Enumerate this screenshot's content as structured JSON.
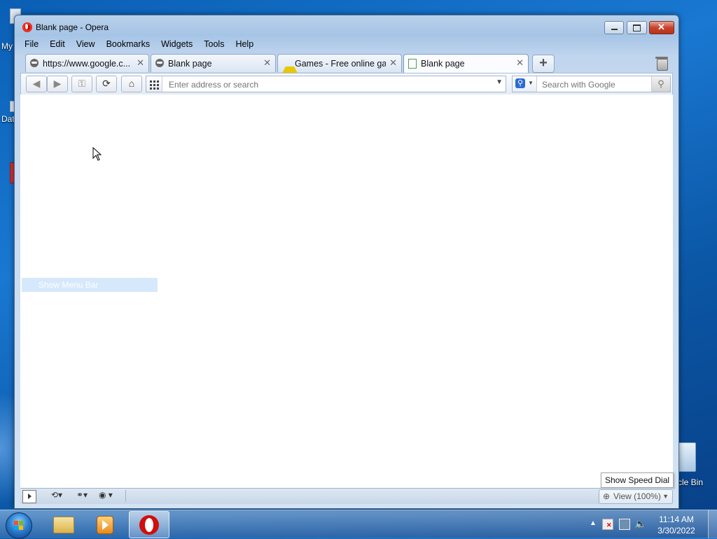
{
  "desktop": {
    "icons": [
      {
        "label": "My"
      },
      {
        "label": "Dat"
      },
      {
        "label": "cle Bin"
      }
    ]
  },
  "window": {
    "title": "Blank page - Opera",
    "menu": [
      "File",
      "Edit",
      "View",
      "Bookmarks",
      "Widgets",
      "Tools",
      "Help"
    ],
    "tabs": [
      {
        "label": "https://www.google.c...",
        "icon": "globe-icon",
        "active": false
      },
      {
        "label": "Blank page",
        "icon": "globe-icon",
        "active": false
      },
      {
        "label": "Games - Free online ga...",
        "icon": "warning-icon",
        "active": false
      },
      {
        "label": "Blank page",
        "icon": "page-icon",
        "active": true
      }
    ],
    "new_tab_label": "+",
    "address": {
      "placeholder": "Enter address or search",
      "value": ""
    },
    "search": {
      "placeholder": "Search with Google",
      "value": ""
    },
    "content": {
      "menu_bar_hint": "Show Menu Bar",
      "speed_dial_tooltip": "Show Speed Dial"
    },
    "status": {
      "zoom_label": "View (100%)"
    }
  },
  "taskbar": {
    "apps": [
      {
        "name": "Windows Explorer",
        "icon": "folder-icon",
        "active": false
      },
      {
        "name": "Windows Media Player",
        "icon": "media-player-icon",
        "active": false
      },
      {
        "name": "Opera",
        "icon": "opera-icon",
        "active": true
      }
    ],
    "clock": {
      "time": "11:14 AM",
      "date": "3/30/2022"
    }
  },
  "colors": {
    "desktop_blue": "#1a78d2",
    "window_frame": "#a6c4e6",
    "opera_red": "#d10d0d",
    "close_red": "#c7432b"
  }
}
